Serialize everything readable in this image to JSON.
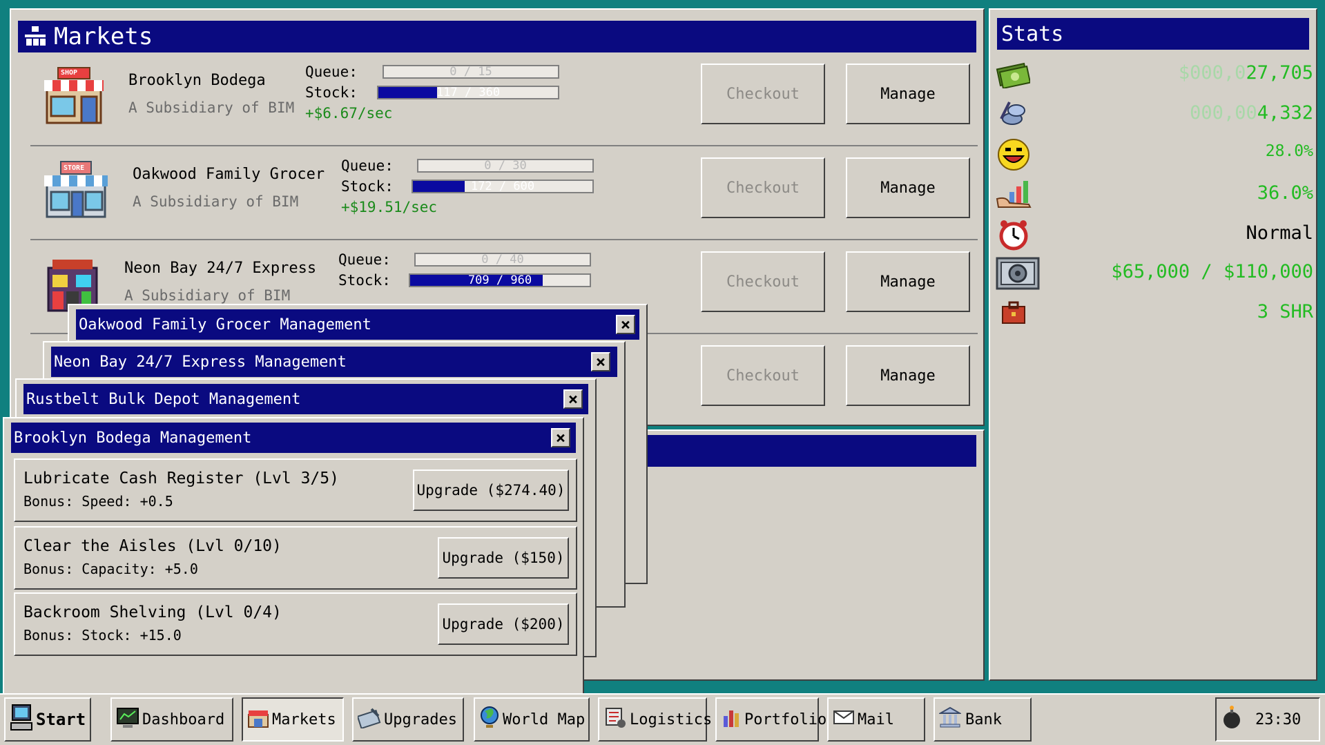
{
  "markets_window": {
    "title": "Markets"
  },
  "markets": [
    {
      "name": "Brooklyn Bodega",
      "subsidiary": "A Subsidiary of BIM",
      "queue_label": "Queue:",
      "queue": "0 / 15",
      "queue_frac": 0.0,
      "stock_label": "Stock:",
      "stock": "117 / 360",
      "stock_frac": 0.325,
      "rate": "+$6.67/sec",
      "checkout": "Checkout",
      "manage": "Manage",
      "sign": "SHOP"
    },
    {
      "name": "Oakwood Family Grocer",
      "subsidiary": "A Subsidiary of BIM",
      "queue_label": "Queue:",
      "queue": "0 / 30",
      "queue_frac": 0.0,
      "stock_label": "Stock:",
      "stock": "172 / 600",
      "stock_frac": 0.29,
      "rate": "+$19.51/sec",
      "checkout": "Checkout",
      "manage": "Manage",
      "sign": "STORE"
    },
    {
      "name": "Neon Bay 24/7 Express",
      "subsidiary": "A Subsidiary of BIM",
      "queue_label": "Queue:",
      "queue": "0 / 40",
      "queue_frac": 0.0,
      "stock_label": "Stock:",
      "stock": "709 / 960",
      "stock_frac": 0.74,
      "checkout": "Checkout",
      "manage": "Manage"
    },
    {
      "checkout": "Checkout",
      "manage": "Manage"
    }
  ],
  "stats_window": {
    "title": "Stats"
  },
  "stats": [
    {
      "icon": "money-stack-icon",
      "dim": "$000,0",
      "value": "27,705"
    },
    {
      "icon": "coins-icon",
      "dim": "000,00",
      "value": "4,332"
    },
    {
      "icon": "happy-face-icon",
      "value": "28.0%"
    },
    {
      "icon": "chart-hand-icon",
      "value": "36.0%"
    },
    {
      "icon": "alarm-clock-icon",
      "value": "Normal"
    },
    {
      "icon": "vault-icon",
      "value": "$65,000 / $110,000"
    },
    {
      "icon": "briefcase-icon",
      "value": "3 SHR"
    }
  ],
  "mgmt_windows": [
    {
      "title": "Oakwood Family Grocer Management"
    },
    {
      "title": "Neon Bay 24/7 Express Management"
    },
    {
      "title": "Rustbelt Bulk Depot Management"
    },
    {
      "title": "Brooklyn Bodega Management"
    }
  ],
  "upgrades": [
    {
      "name": "Lubricate Cash Register (Lvl 3/5)",
      "bonus": "Bonus: Speed: +0.5",
      "button": "Upgrade ($274.40)"
    },
    {
      "name": "Clear the Aisles (Lvl 0/10)",
      "bonus": "Bonus: Capacity: +5.0",
      "button": "Upgrade ($150)"
    },
    {
      "name": "Backroom Shelving (Lvl 0/4)",
      "bonus": "Bonus: Stock: +15.0",
      "button": "Upgrade ($200)"
    }
  ],
  "taskbar": {
    "start": "Start",
    "items": [
      "Dashboard",
      "Markets",
      "Upgrades",
      "World Map",
      "Logistics",
      "Portfolio",
      "Mail",
      "Bank"
    ],
    "clock": "23:30"
  },
  "colors": {
    "desktop": "#10807f",
    "titlebar": "#0a0a80",
    "window": "#d4d0c8",
    "money": "#22bb22"
  }
}
